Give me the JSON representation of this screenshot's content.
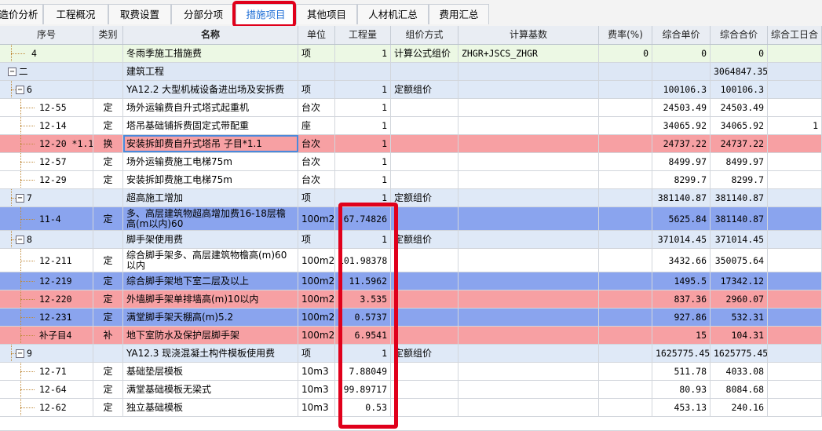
{
  "tabs": [
    {
      "label": "造价分析",
      "active": false
    },
    {
      "label": "工程概况",
      "active": false
    },
    {
      "label": "取费设置",
      "active": false
    },
    {
      "label": "分部分项",
      "active": false
    },
    {
      "label": "措施项目",
      "active": true
    },
    {
      "label": "其他项目",
      "active": false
    },
    {
      "label": "人材机汇总",
      "active": false
    },
    {
      "label": "费用汇总",
      "active": false
    }
  ],
  "columns": [
    "序号",
    "类别",
    "名称",
    "单位",
    "工程量",
    "组价方式",
    "计算基数",
    "费率(%)",
    "综合单价",
    "综合合价",
    "综合工日合"
  ],
  "colors": {
    "highlight_red": "#e0001b",
    "row_pink": "#f7a0a3",
    "row_blue": "#8aa4ee",
    "row_group": "#dde7f5",
    "row_green": "#ecf8e4"
  },
  "rows": [
    {
      "seq": "4",
      "type": "",
      "name": "冬雨季施工措施费",
      "unit": "项",
      "qty": "1",
      "method": "计算公式组价",
      "base": "ZHGR+JSCS_ZHGR",
      "rate": "0",
      "price": "0",
      "total": "0",
      "labor": "",
      "style": "green",
      "level": 1
    },
    {
      "seq": "二",
      "type": "",
      "name": "建筑工程",
      "unit": "",
      "qty": "",
      "method": "",
      "base": "",
      "rate": "",
      "price": "",
      "total": "3064847.35",
      "labor": "",
      "style": "group",
      "level": 0,
      "expand": "−"
    },
    {
      "seq": "6",
      "type": "",
      "name": "YA12.2  大型机械设备进出场及安拆费",
      "unit": "项",
      "qty": "1",
      "method": "定额组价",
      "base": "",
      "rate": "",
      "price": "100106.3",
      "total": "100106.3",
      "labor": "",
      "style": "sub",
      "level": 1,
      "expand": "−"
    },
    {
      "seq": "12-55",
      "type": "定",
      "name": "场外运输费自升式塔式起重机",
      "unit": "台次",
      "qty": "1",
      "method": "",
      "base": "",
      "rate": "",
      "price": "24503.49",
      "total": "24503.49",
      "labor": "",
      "style": "white",
      "level": 2
    },
    {
      "seq": "12-14",
      "type": "定",
      "name": "塔吊基础铺拆费固定式带配重",
      "unit": "座",
      "qty": "1",
      "method": "",
      "base": "",
      "rate": "",
      "price": "34065.92",
      "total": "34065.92",
      "labor": "1",
      "style": "white",
      "level": 2
    },
    {
      "seq": "12-20 *1.1",
      "type": "换",
      "name": "安装拆卸费自升式塔吊  子目*1.1",
      "unit": "台次",
      "qty": "1",
      "method": "",
      "base": "",
      "rate": "",
      "price": "24737.22",
      "total": "24737.22",
      "labor": "",
      "style": "pink",
      "level": 2,
      "selected": true
    },
    {
      "seq": "12-57",
      "type": "定",
      "name": "场外运输费施工电梯75m",
      "unit": "台次",
      "qty": "1",
      "method": "",
      "base": "",
      "rate": "",
      "price": "8499.97",
      "total": "8499.97",
      "labor": "",
      "style": "white",
      "level": 2
    },
    {
      "seq": "12-29",
      "type": "定",
      "name": "安装拆卸费施工电梯75m",
      "unit": "台次",
      "qty": "1",
      "method": "",
      "base": "",
      "rate": "",
      "price": "8299.7",
      "total": "8299.7",
      "labor": "",
      "style": "white",
      "level": 2
    },
    {
      "seq": "7",
      "type": "",
      "name": "超高施工增加",
      "unit": "项",
      "qty": "1",
      "method": "定额组价",
      "base": "",
      "rate": "",
      "price": "381140.87",
      "total": "381140.87",
      "labor": "",
      "style": "sub",
      "level": 1,
      "expand": "−"
    },
    {
      "seq": "11-4",
      "type": "定",
      "name": "多、高层建筑物超高增加费16-18层檐高(m以内)60",
      "unit": "100m2",
      "qty": "67.74826",
      "method": "",
      "base": "",
      "rate": "",
      "price": "5625.84",
      "total": "381140.87",
      "labor": "",
      "style": "blue",
      "level": 2,
      "tall": true
    },
    {
      "seq": "8",
      "type": "",
      "name": "脚手架使用费",
      "unit": "项",
      "qty": "1",
      "method": "定额组价",
      "base": "",
      "rate": "",
      "price": "371014.45",
      "total": "371014.45",
      "labor": "",
      "style": "sub",
      "level": 1,
      "expand": "−"
    },
    {
      "seq": "12-211",
      "type": "定",
      "name": "综合脚手架多、高层建筑物檐高(m)60以内",
      "unit": "100m2",
      "qty": "101.98378",
      "method": "",
      "base": "",
      "rate": "",
      "price": "3432.66",
      "total": "350075.64",
      "labor": "",
      "style": "white",
      "level": 2,
      "tall": true
    },
    {
      "seq": "12-219",
      "type": "定",
      "name": "综合脚手架地下室二层及以上",
      "unit": "100m2",
      "qty": "11.5962",
      "method": "",
      "base": "",
      "rate": "",
      "price": "1495.5",
      "total": "17342.12",
      "labor": "",
      "style": "blue",
      "level": 2
    },
    {
      "seq": "12-220",
      "type": "定",
      "name": "外墙脚手架单排墙高(m)10以内",
      "unit": "100m2",
      "qty": "3.535",
      "method": "",
      "base": "",
      "rate": "",
      "price": "837.36",
      "total": "2960.07",
      "labor": "",
      "style": "pink",
      "level": 2
    },
    {
      "seq": "12-231",
      "type": "定",
      "name": "满堂脚手架天棚高(m)5.2",
      "unit": "100m2",
      "qty": "0.5737",
      "method": "",
      "base": "",
      "rate": "",
      "price": "927.86",
      "total": "532.31",
      "labor": "",
      "style": "blue",
      "level": 2
    },
    {
      "seq": "补子目4",
      "type": "补",
      "name": "地下室防水及保护层脚手架",
      "unit": "100m2",
      "qty": "6.9541",
      "method": "",
      "base": "",
      "rate": "",
      "price": "15",
      "total": "104.31",
      "labor": "",
      "style": "pink",
      "level": 2
    },
    {
      "seq": "9",
      "type": "",
      "name": "YA12.3  现浇混凝土构件模板使用费",
      "unit": "项",
      "qty": "1",
      "method": "定额组价",
      "base": "",
      "rate": "",
      "price": "1625775.45",
      "total": "1625775.45",
      "labor": "",
      "style": "sub",
      "level": 1,
      "expand": "−"
    },
    {
      "seq": "12-71",
      "type": "定",
      "name": "基础垫层模板",
      "unit": "10m3",
      "qty": "7.88049",
      "method": "",
      "base": "",
      "rate": "",
      "price": "511.78",
      "total": "4033.08",
      "labor": "",
      "style": "white",
      "level": 2
    },
    {
      "seq": "12-64",
      "type": "定",
      "name": "满堂基础模板无梁式",
      "unit": "10m3",
      "qty": "99.89717",
      "method": "",
      "base": "",
      "rate": "",
      "price": "80.93",
      "total": "8084.68",
      "labor": "",
      "style": "white",
      "level": 2
    },
    {
      "seq": "12-62",
      "type": "定",
      "name": "独立基础模板",
      "unit": "10m3",
      "qty": "0.53",
      "method": "",
      "base": "",
      "rate": "",
      "price": "453.13",
      "total": "240.16",
      "labor": "",
      "style": "white",
      "level": 2
    }
  ]
}
